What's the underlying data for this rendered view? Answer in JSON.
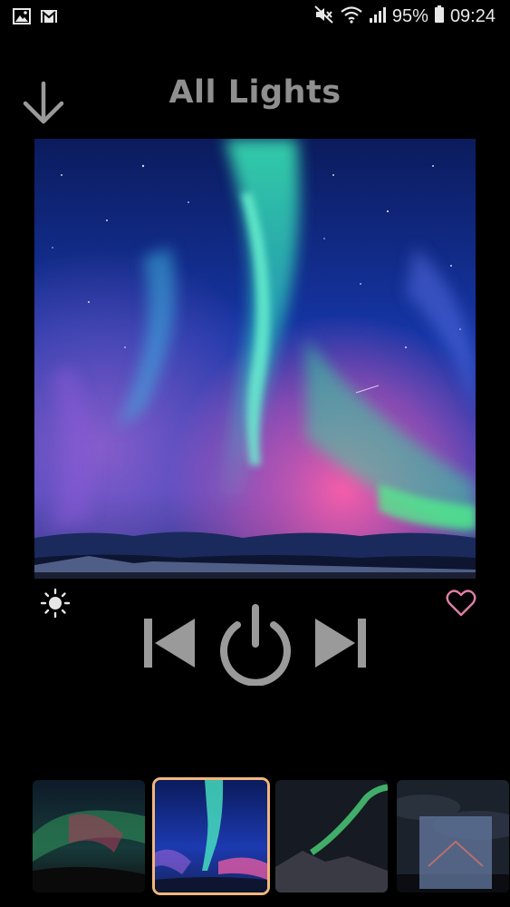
{
  "status_bar": {
    "battery": "95%",
    "time": "09:24",
    "icons": [
      "gallery-icon",
      "gmail-icon",
      "mute-icon",
      "wifi-icon",
      "signal-icon",
      "battery-icon"
    ]
  },
  "header": {
    "title": "All Lights",
    "back_icon": "arrow-down-icon"
  },
  "hero": {
    "image": "aurora-borealis-image"
  },
  "controls": {
    "brightness_icon": "sun-icon",
    "favorite_icon": "heart-outline-icon",
    "prev_icon": "skip-previous-icon",
    "power_icon": "power-icon",
    "next_icon": "skip-next-icon"
  },
  "thumbnails": [
    {
      "image": "aurora-green-red-thumbnail",
      "selected": false
    },
    {
      "image": "aurora-blue-pink-thumbnail",
      "selected": true
    },
    {
      "image": "aurora-green-arc-thumbnail",
      "selected": false
    },
    {
      "image": "night-clouds-thumbnail",
      "selected": false
    }
  ],
  "colors": {
    "background": "#000000",
    "title": "#8f8f8f",
    "controls": "#9a9a9a",
    "favorite": "#e07fa6",
    "selected_border": "#f1b77b",
    "scroll_top_bg": "#6479a0",
    "scroll_top_chevron": "#e98a86"
  }
}
